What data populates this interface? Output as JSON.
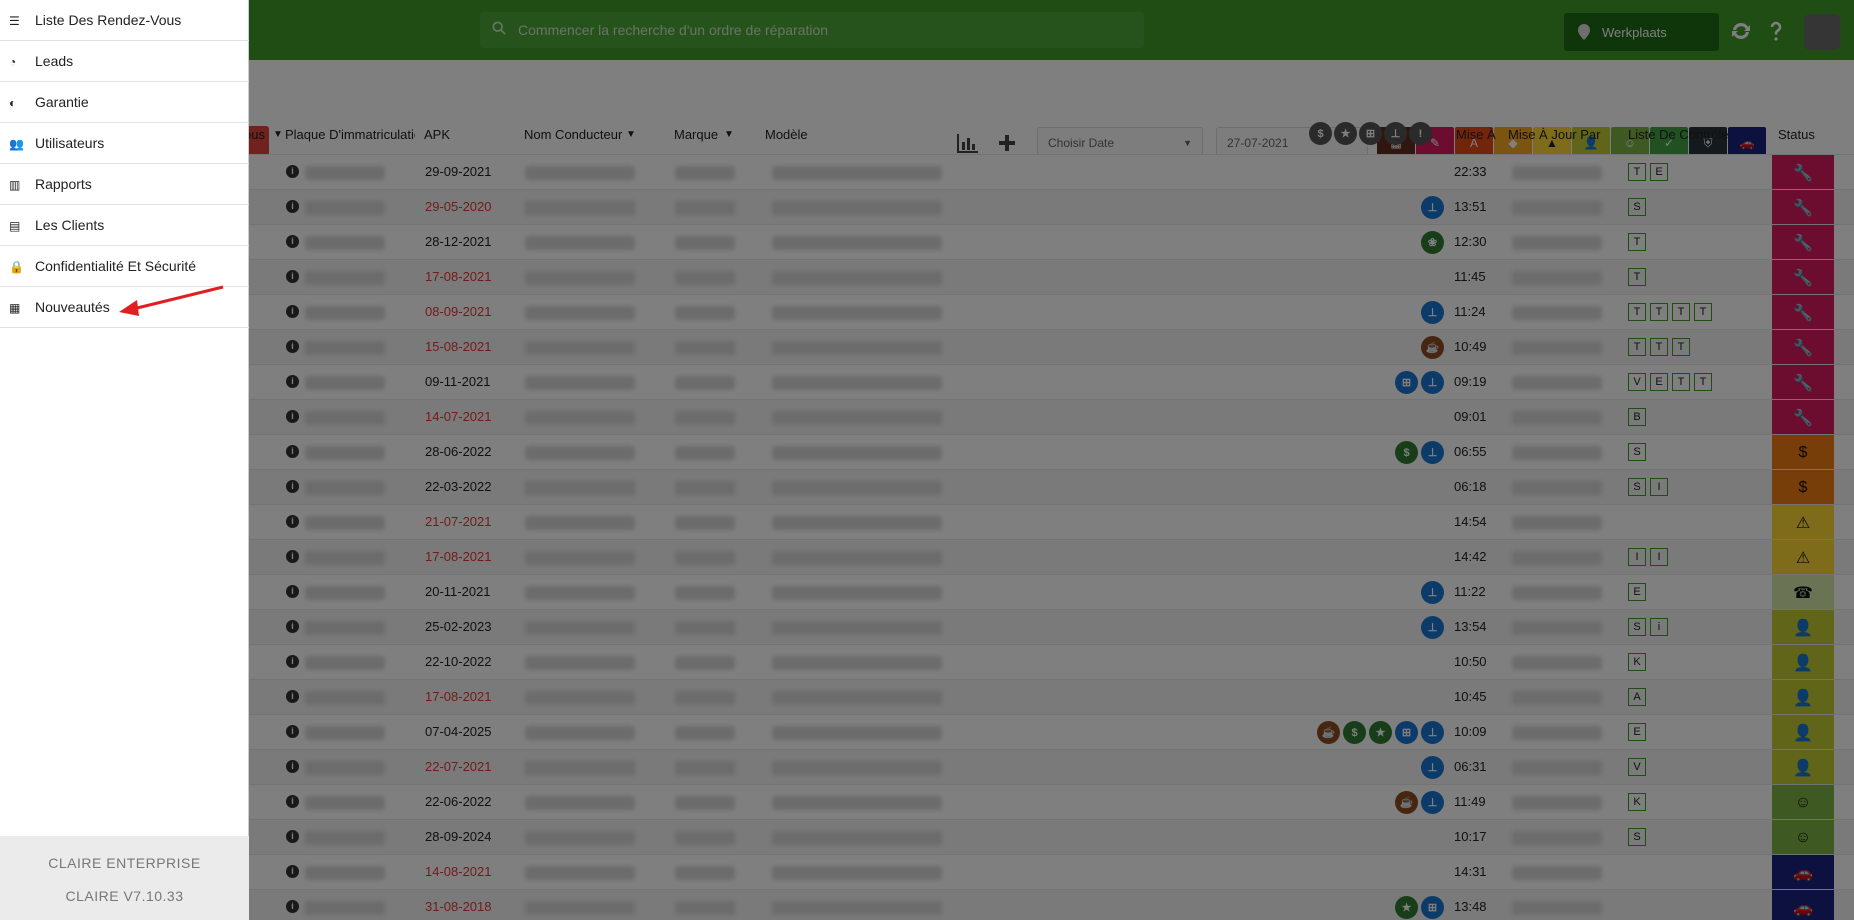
{
  "search": {
    "placeholder": "Commencer la recherche d'un ordre de réparation"
  },
  "location": {
    "label": "Werkplaats"
  },
  "toolbar": {
    "date_select": "Choisir Date",
    "date_value": "27-07-2021"
  },
  "filter_colors": [
    "#5e2e1e",
    "#d81b60",
    "#e64a19",
    "#f9a825",
    "#fdd835",
    "#c0ca33",
    "#7cb342",
    "#43a047",
    "#263238",
    "#1a237e"
  ],
  "table": {
    "headers": {
      "rdv": "ous",
      "plaque": "Plaque D'immatriculatio",
      "apk": "APK",
      "conducteur": "Nom Conducteur",
      "marque": "Marque",
      "modele": "Modèle",
      "mise_a": "Mise À",
      "mise_par": "Mise À Jour Par",
      "liste": "Liste De Contrôle",
      "status": "Status"
    },
    "rows": [
      {
        "apk": "29-09-2021",
        "late": false,
        "time": "22:33",
        "checks": [
          "T",
          "E"
        ],
        "status": "wrench",
        "icons": []
      },
      {
        "apk": "29-05-2020",
        "late": true,
        "time": "13:51",
        "checks": [
          "S"
        ],
        "status": "wrench",
        "icons": [
          "pin"
        ]
      },
      {
        "apk": "28-12-2021",
        "late": false,
        "time": "12:30",
        "checks": [
          "T"
        ],
        "status": "wrench",
        "icons": [
          "leaf"
        ]
      },
      {
        "apk": "17-08-2021",
        "late": true,
        "time": "11:45",
        "checks": [
          "T"
        ],
        "status": "wrench",
        "icons": []
      },
      {
        "apk": "08-09-2021",
        "late": true,
        "time": "11:24",
        "checks": [
          "T",
          "T",
          "T",
          "T"
        ],
        "status": "wrench",
        "icons": [
          "pin"
        ]
      },
      {
        "apk": "15-08-2021",
        "late": true,
        "time": "10:49",
        "checks": [
          "T",
          "T",
          "T"
        ],
        "status": "wrench",
        "icons": [
          "coffee"
        ]
      },
      {
        "apk": "09-11-2021",
        "late": false,
        "time": "09:19",
        "checks": [
          "V",
          "E",
          "T",
          "T"
        ],
        "status": "wrench",
        "icons": [
          "cart",
          "pin"
        ]
      },
      {
        "apk": "14-07-2021",
        "late": true,
        "time": "09:01",
        "checks": [
          "B"
        ],
        "status": "wrench",
        "icons": []
      },
      {
        "apk": "28-06-2022",
        "late": false,
        "time": "06:55",
        "checks": [
          "S"
        ],
        "status": "dollar",
        "icons": [
          "dollar",
          "pin"
        ]
      },
      {
        "apk": "22-03-2022",
        "late": false,
        "time": "06:18",
        "checks": [
          "S",
          "I"
        ],
        "status": "dollar",
        "icons": []
      },
      {
        "apk": "21-07-2021",
        "late": true,
        "time": "14:54",
        "checks": [],
        "status": "warning",
        "icons": []
      },
      {
        "apk": "17-08-2021",
        "late": true,
        "time": "14:42",
        "checks": [
          "I",
          "I"
        ],
        "status": "warning",
        "icons": []
      },
      {
        "apk": "20-11-2021",
        "late": false,
        "time": "11:22",
        "checks": [
          "E"
        ],
        "status": "phone",
        "icons": [
          "pin"
        ]
      },
      {
        "apk": "25-02-2023",
        "late": false,
        "time": "13:54",
        "checks": [
          "S",
          "i"
        ],
        "status": "user",
        "icons": [
          "pin"
        ]
      },
      {
        "apk": "22-10-2022",
        "late": false,
        "time": "10:50",
        "checks": [
          "K"
        ],
        "status": "user",
        "icons": []
      },
      {
        "apk": "17-08-2021",
        "late": true,
        "time": "10:45",
        "checks": [
          "A"
        ],
        "status": "user",
        "icons": []
      },
      {
        "apk": "07-04-2025",
        "late": false,
        "time": "10:09",
        "checks": [
          "E"
        ],
        "status": "user",
        "icons": [
          "coffee",
          "dollar",
          "star",
          "cart",
          "pin"
        ]
      },
      {
        "apk": "22-07-2021",
        "late": true,
        "time": "06:31",
        "checks": [
          "V"
        ],
        "status": "user",
        "icons": [
          "pin"
        ]
      },
      {
        "apk": "22-06-2022",
        "late": false,
        "time": "11:49",
        "checks": [
          "K"
        ],
        "status": "smile",
        "icons": [
          "coffee",
          "pin"
        ]
      },
      {
        "apk": "28-09-2024",
        "late": false,
        "time": "10:17",
        "checks": [
          "S"
        ],
        "status": "smile",
        "icons": []
      },
      {
        "apk": "14-08-2021",
        "late": true,
        "time": "14:31",
        "checks": [],
        "status": "car",
        "icons": []
      },
      {
        "apk": "31-08-2018",
        "late": true,
        "time": "13:48",
        "checks": [],
        "status": "car",
        "icons": [
          "star",
          "cart"
        ]
      }
    ]
  },
  "menu": {
    "items": [
      {
        "label": "Liste Des Rendez-Vous",
        "icon": "list-icon"
      },
      {
        "label": "Leads",
        "icon": "clock-icon"
      },
      {
        "label": "Garantie",
        "icon": "shield-icon"
      },
      {
        "label": "Utilisateurs",
        "icon": "users-icon"
      },
      {
        "label": "Rapports",
        "icon": "chart-icon"
      },
      {
        "label": "Les Clients",
        "icon": "id-card-icon"
      },
      {
        "label": "Confidentialité Et Sécurité",
        "icon": "lock-icon"
      },
      {
        "label": "Nouveautés",
        "icon": "news-icon"
      }
    ],
    "footer": {
      "edition": "CLAIRE ENTERPRISE",
      "version": "CLAIRE V7.10.33"
    }
  }
}
